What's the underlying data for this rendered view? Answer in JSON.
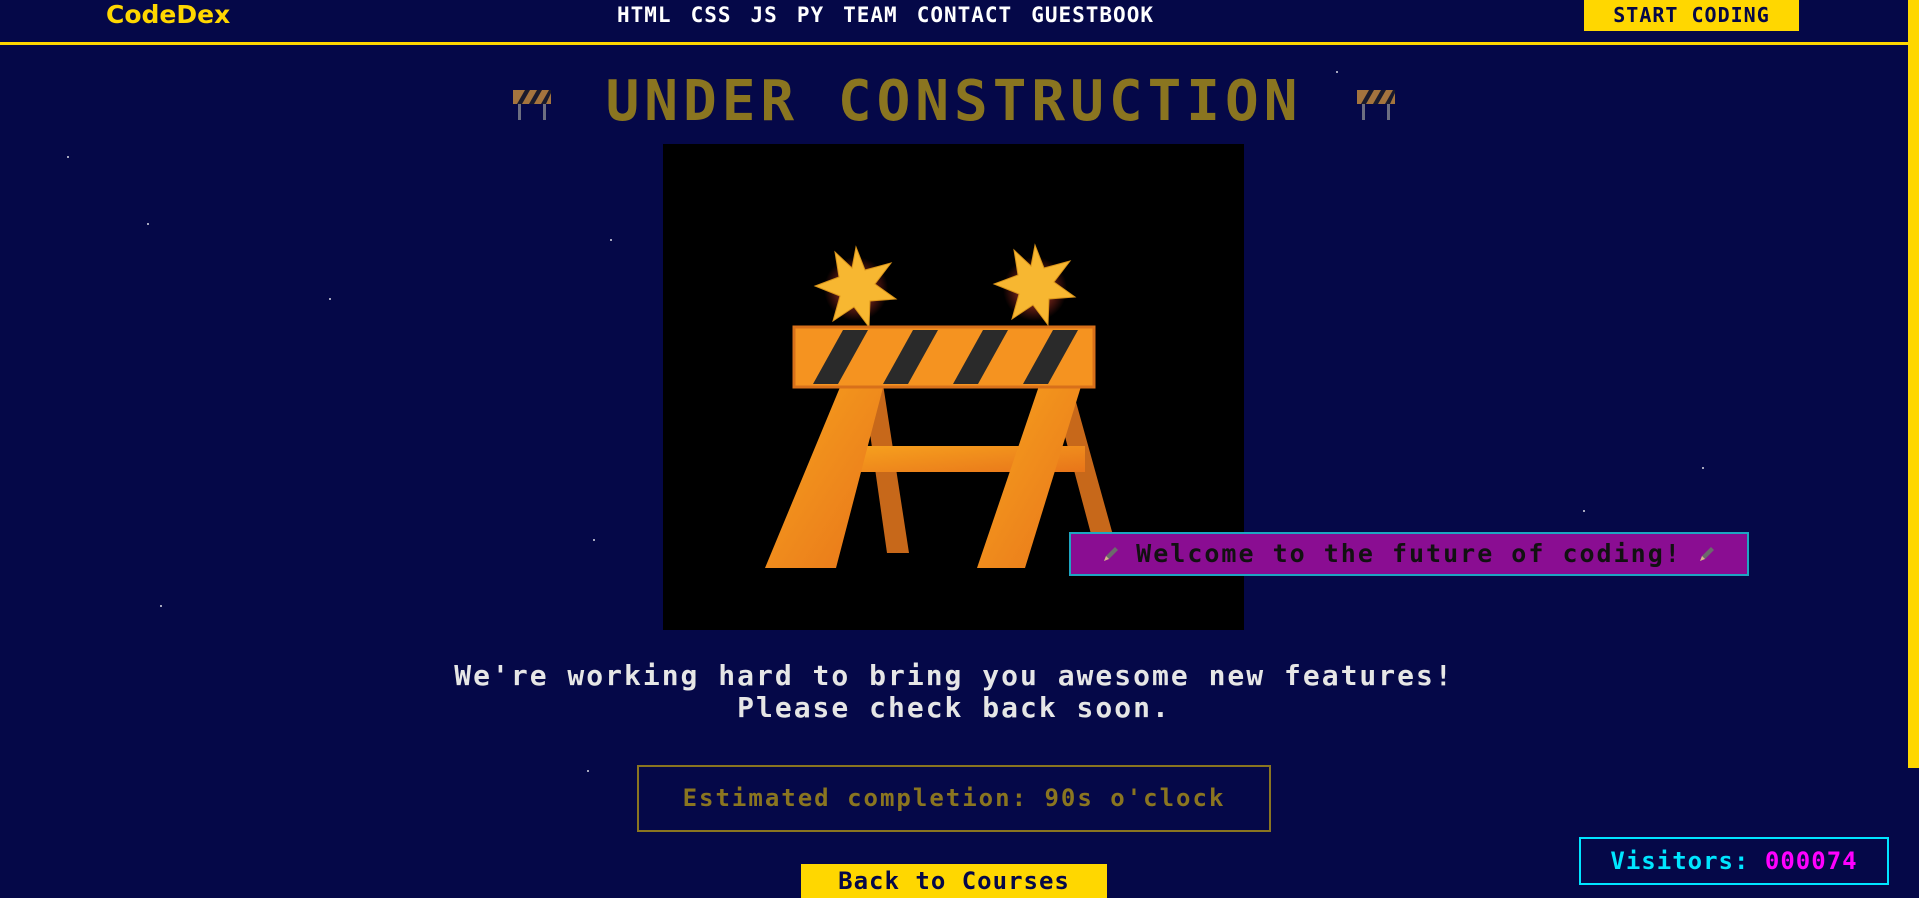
{
  "header": {
    "brand": "CodeDex",
    "nav": [
      "HTML",
      "CSS",
      "JS",
      "PY",
      "TEAM",
      "CONTACT",
      "GUESTBOOK"
    ],
    "cta": "START CODING"
  },
  "main": {
    "title": "UNDER CONSTRUCTION",
    "banner": "Welcome to the future of coding!",
    "message_line1": "We're working hard to bring you awesome new features!",
    "message_line2": "Please check back soon.",
    "estimate": "Estimated completion: 90s o'clock",
    "back_button": "Back to Courses"
  },
  "visitors": {
    "label": "Visitors:",
    "count": "000074"
  },
  "icons": {
    "title_left": "construction-barrier-icon",
    "title_right": "construction-barrier-icon",
    "banner_left": "pencil-icon",
    "banner_right": "pencil-icon",
    "illustration": "construction-barrier-illustration"
  },
  "colors": {
    "background": "#050848",
    "accent": "#ffd700",
    "title": "#8a7520",
    "banner_bg": "#8a0d92",
    "visitors_label": "#00e5ff",
    "visitors_count": "#ff00ff"
  }
}
